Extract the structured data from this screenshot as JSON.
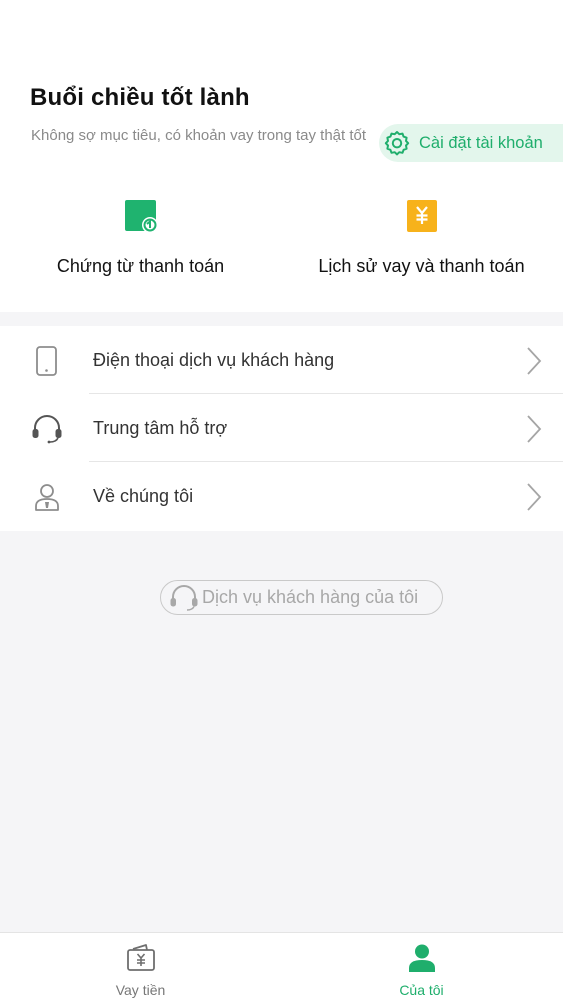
{
  "header": {
    "greeting": "Buổi chiều tốt lành",
    "subtitle": "Không sợ mục tiêu, có khoản vay trong tay thật tốt",
    "account_settings_label": "Cài đặt tài khoản"
  },
  "quick_actions": [
    {
      "label": "Chứng từ thanh toán",
      "icon": "payment-voucher-icon",
      "color": "#1fb36f"
    },
    {
      "label": "Lịch sử vay và thanh toán",
      "icon": "yuan-history-icon",
      "color": "#f7b21b"
    }
  ],
  "menu": {
    "items": [
      {
        "label": "Điện thoại dịch vụ khách hàng",
        "icon": "phone-icon"
      },
      {
        "label": "Trung tâm hỗ trợ",
        "icon": "headset-icon"
      },
      {
        "label": "Về chúng tôi",
        "icon": "person-icon"
      }
    ]
  },
  "service_button": {
    "label": "Dịch vụ khách hàng của tôi",
    "icon": "headset-icon"
  },
  "tabbar": {
    "tabs": [
      {
        "label": "Vay tiền",
        "icon": "wallet-yuan-icon",
        "active": false
      },
      {
        "label": "Của tôi",
        "icon": "user-icon",
        "active": true
      }
    ]
  },
  "colors": {
    "accent": "#1fae6c",
    "accent_bg": "#e3f6ec",
    "warning": "#f7b21b",
    "page_bg": "#f5f5f7"
  }
}
